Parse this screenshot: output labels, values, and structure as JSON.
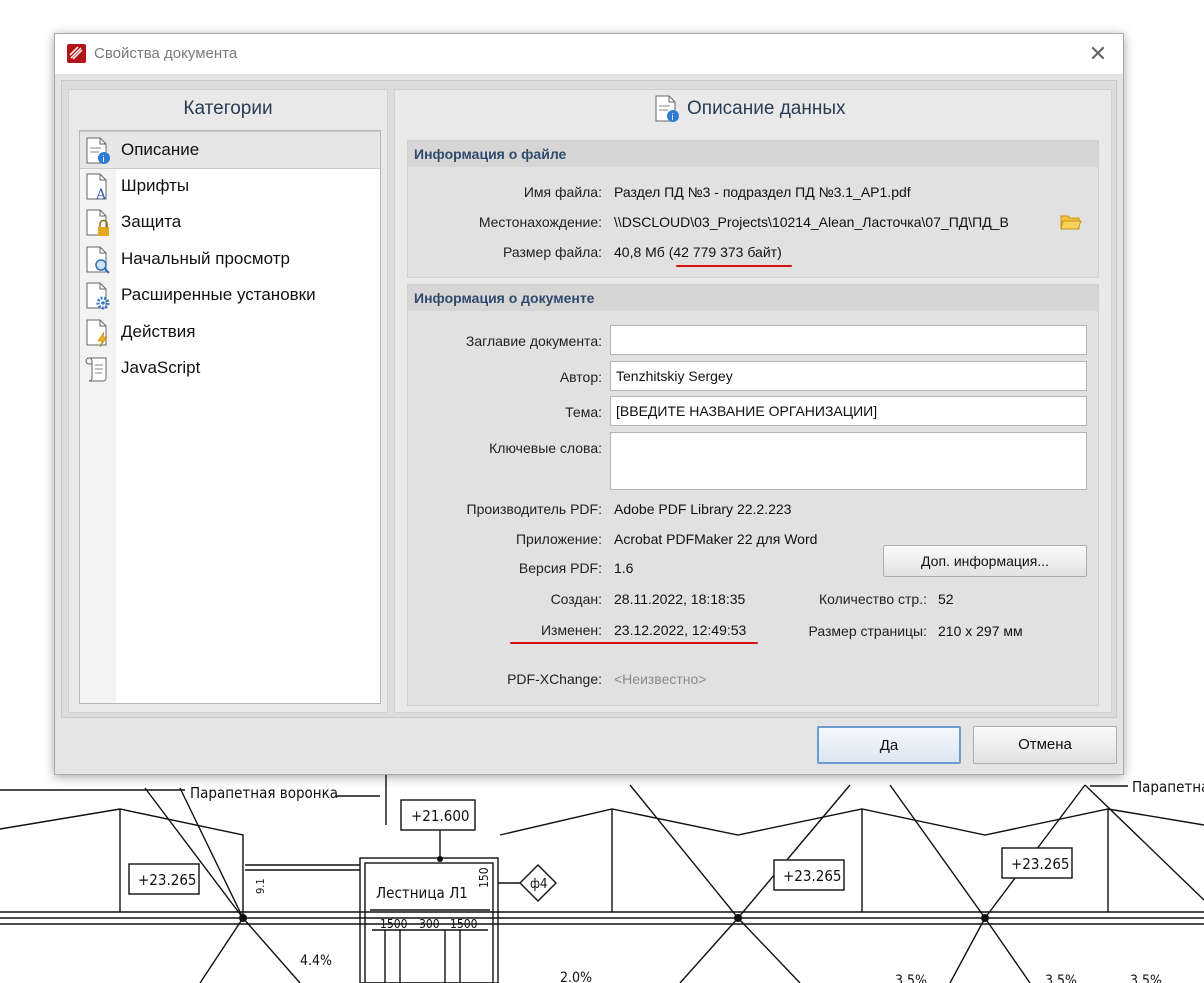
{
  "dialog": {
    "title": "Свойства документа",
    "close_glyph": "✕"
  },
  "categories": {
    "header": "Категории",
    "items": [
      {
        "label": "Описание",
        "icon": "doc-info-icon",
        "selected": true
      },
      {
        "label": "Шрифты",
        "icon": "doc-font-icon",
        "selected": false
      },
      {
        "label": "Защита",
        "icon": "doc-lock-icon",
        "selected": false
      },
      {
        "label": "Начальный просмотр",
        "icon": "doc-zoom-icon",
        "selected": false
      },
      {
        "label": "Расширенные установки",
        "icon": "doc-gear-icon",
        "selected": false
      },
      {
        "label": "Действия",
        "icon": "doc-lightning-icon",
        "selected": false
      },
      {
        "label": "JavaScript",
        "icon": "scroll-icon",
        "selected": false
      }
    ]
  },
  "description": {
    "header": "Описание данных",
    "file_info": {
      "title": "Информация о файле",
      "filename_label": "Имя файла:",
      "filename": "Раздел ПД №3 - подраздел ПД №3.1_АР1.pdf",
      "location_label": "Местонахождение:",
      "location": "\\\\DSCLOUD\\03_Projects\\10214_Alean_Ласточка\\07_ПД\\ПД_В",
      "size_label": "Размер файла:",
      "size_mb": "40,8 Мб (",
      "size_bytes": "42 779 373 байт",
      "size_tail": ")"
    },
    "doc_info": {
      "title": "Информация о документе",
      "title_label": "Заглавие документа:",
      "title_value": "",
      "author_label": "Автор:",
      "author_value": "Tenzhitskiy Sergey",
      "subject_label": "Тема:",
      "subject_value": "[ВВЕДИТЕ НАЗВАНИЕ ОРГАНИЗАЦИИ]",
      "keywords_label": "Ключевые слова:",
      "keywords_value": "",
      "producer_label": "Производитель PDF:",
      "producer_value": "Adobe PDF Library 22.2.223",
      "app_label": "Приложение:",
      "app_value": "Acrobat PDFMaker 22 для Word",
      "version_label": "Версия PDF:",
      "version_value": "1.6",
      "more_info_button": "Доп. информация...",
      "created_label": "Создан:",
      "created_value": "28.11.2022, 18:18:35",
      "pages_label": "Количество стр.:",
      "pages_value": "52",
      "modified_label": "Изменен:",
      "modified_value": "23.12.2022, 12:49:53",
      "page_size_label": "Размер страницы:",
      "page_size_value": "210 x 297 мм",
      "pdfxchange_label": "PDF-XChange:",
      "pdfxchange_value": "<Неизвестно>"
    }
  },
  "footer": {
    "ok": "Да",
    "cancel": "Отмена"
  },
  "drawing": {
    "label_left": "Парапетная воронка",
    "label_right": "Парапетна",
    "level_center": "+21.600",
    "level_1": "+23.265",
    "level_2": "+23.265",
    "level_3": "+23.265",
    "stair": "Лестница Л1",
    "axis": "ф4",
    "dim_1": "1500",
    "dim_2": "300",
    "dim_3": "1500",
    "dim_side": "150",
    "dim_left": "9.1",
    "slope_1": "4.4%",
    "slope_2": "2.0%",
    "slope_3": "3.5%",
    "slope_4": "3.5%",
    "slope_5": "3.5%"
  },
  "colors": {
    "accent_red": "#d41111",
    "header_blue": "#2a3c54",
    "group_title_blue": "#2f4a6d"
  }
}
